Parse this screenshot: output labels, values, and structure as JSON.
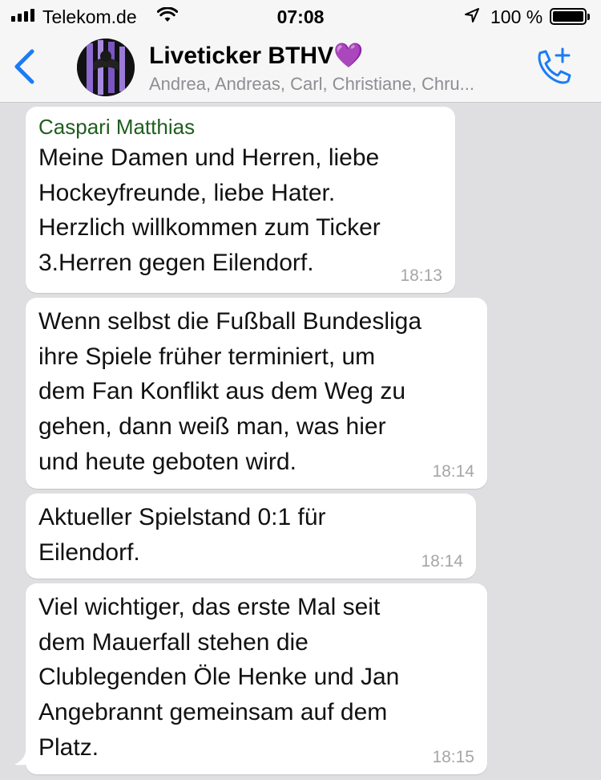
{
  "status_bar": {
    "carrier": "Telekom.de",
    "time": "07:08",
    "battery": "100 %",
    "battery_level": 1.0
  },
  "header": {
    "title": "Liveticker BTHV",
    "emoji": "💜",
    "subtitle": "Andrea, Andreas, Carl, Christiane, Chru..."
  },
  "messages": [
    {
      "sender": "Caspari Matthias",
      "text": "Meine Damen und Herren, liebe\nHockeyfreunde, liebe Hater.\nHerzlich willkommen zum Ticker\n3.Herren gegen Eilendorf.",
      "time": "18:13"
    },
    {
      "text": "Wenn selbst die Fußball Bundesliga\nihre Spiele früher terminiert, um\ndem Fan Konflikt aus dem Weg zu\ngehen, dann weiß man, was hier\nund heute geboten wird.",
      "time": "18:14"
    },
    {
      "text": "Aktueller Spielstand 0:1 für\nEilendorf.",
      "time": "18:14"
    },
    {
      "text": "Viel wichtiger, das erste Mal seit\ndem Mauerfall stehen die\nClublegenden Öle Henke und Jan\nAngebrannt gemeinsam auf dem\nPlatz.",
      "time": "18:15"
    }
  ],
  "colors": {
    "accent": "#1a7cf5",
    "sender_name": "#1f5e1f",
    "chat_background": "#dfdfe2",
    "bubble": "#ffffff",
    "timestamp": "#a6a6a6"
  },
  "icons": {
    "back": "chevron-left-icon",
    "add_call": "phone-plus-icon",
    "location": "location-arrow-icon",
    "wifi": "wifi-icon",
    "signal": "signal-bars-icon"
  }
}
